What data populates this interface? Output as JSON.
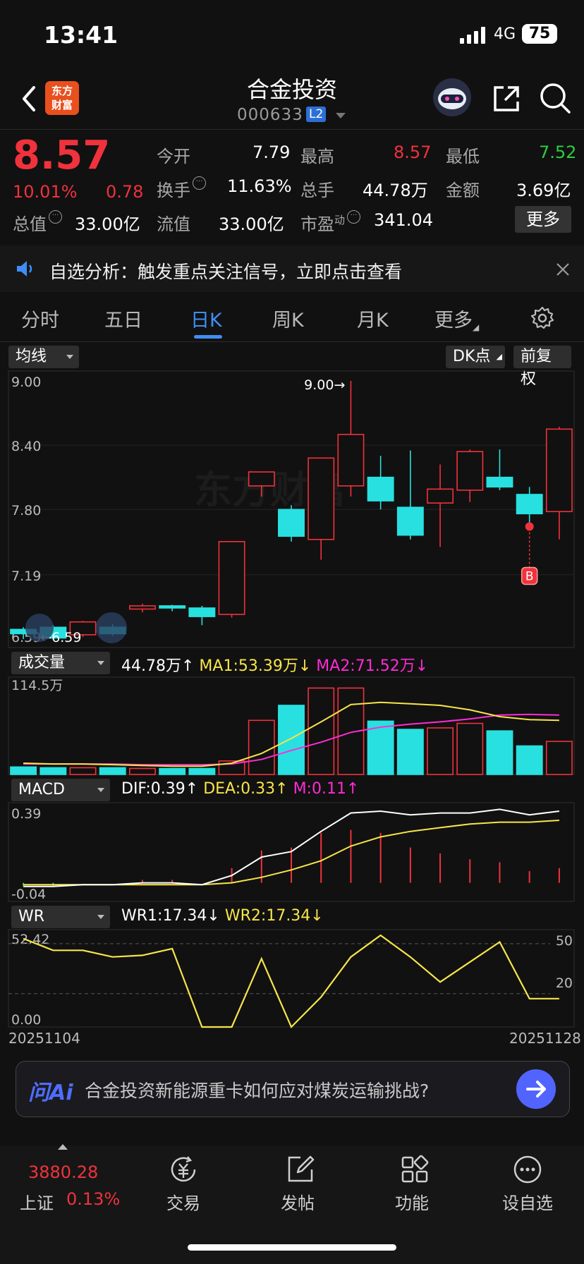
{
  "status_bar": {
    "time": "13:41",
    "network": "4G",
    "battery": "75"
  },
  "header": {
    "name": "合金投资",
    "code": "000633",
    "level": "L2",
    "logo_line1": "东方",
    "logo_line2": "财富"
  },
  "quote": {
    "price": "8.57",
    "change_pct": "10.01%",
    "change": "0.78",
    "open_label": "今开",
    "open": "7.79",
    "high_label": "最高",
    "high": "8.57",
    "low_label": "最低",
    "low": "7.52",
    "turnover_label": "换手",
    "turnover": "11.63%",
    "volume_label": "总手",
    "volume": "44.78万",
    "amount_label": "金额",
    "amount": "3.69亿",
    "total_cap_label": "总值",
    "total_cap": "33.00亿",
    "float_cap_label": "流值",
    "float_cap": "33.00亿",
    "pe_label": "市盈",
    "pe_sup": "动",
    "pe": "341.04",
    "more_label": "更多",
    "colors": {
      "up": "#f0323c",
      "down": "#2ecc40"
    }
  },
  "notice": {
    "text": "自选分析：触发重点关注信号，立即点击查看"
  },
  "tabs": [
    {
      "label": "分时"
    },
    {
      "label": "五日"
    },
    {
      "label": "日K",
      "active": true
    },
    {
      "label": "周K"
    },
    {
      "label": "月K"
    },
    {
      "label": "更多"
    }
  ],
  "kline_toolbar": {
    "ma_label": "均线",
    "dk_label": "DK点",
    "adjust_label": "前复权"
  },
  "chart_data": [
    {
      "type": "candlestick",
      "name": "日K",
      "y_ticks": [
        "9.00",
        "8.40",
        "7.80",
        "7.19",
        "6.59"
      ],
      "ylim": [
        6.59,
        9.0
      ],
      "max_label": "9.00→",
      "min_label": "←6.59",
      "signal_marker": "B",
      "watermark": "东方财富",
      "colors": {
        "up": "#f0323c",
        "down": "#28e0e0"
      },
      "candles": [
        {
          "o": 6.68,
          "c": 6.64,
          "h": 6.7,
          "l": 6.59
        },
        {
          "o": 6.7,
          "c": 6.6,
          "h": 6.72,
          "l": 6.59
        },
        {
          "o": 6.63,
          "c": 6.75,
          "h": 6.76,
          "l": 6.61
        },
        {
          "o": 6.7,
          "c": 6.64,
          "h": 6.73,
          "l": 6.62
        },
        {
          "o": 6.87,
          "c": 6.9,
          "h": 6.92,
          "l": 6.84
        },
        {
          "o": 6.9,
          "c": 6.88,
          "h": 6.91,
          "l": 6.85
        },
        {
          "o": 6.88,
          "c": 6.8,
          "h": 6.9,
          "l": 6.72
        },
        {
          "o": 6.82,
          "c": 7.5,
          "h": 7.5,
          "l": 6.79
        },
        {
          "o": 8.02,
          "c": 8.15,
          "h": 8.15,
          "l": 7.92
        },
        {
          "o": 7.8,
          "c": 7.55,
          "h": 7.84,
          "l": 7.5
        },
        {
          "o": 7.52,
          "c": 8.28,
          "h": 8.28,
          "l": 7.33
        },
        {
          "o": 8.02,
          "c": 8.5,
          "h": 9.0,
          "l": 7.92
        },
        {
          "o": 8.1,
          "c": 7.88,
          "h": 8.3,
          "l": 7.8
        },
        {
          "o": 7.82,
          "c": 7.56,
          "h": 8.35,
          "l": 7.52
        },
        {
          "o": 7.86,
          "c": 7.99,
          "h": 8.22,
          "l": 7.45
        },
        {
          "o": 7.98,
          "c": 8.34,
          "h": 8.36,
          "l": 7.87
        },
        {
          "o": 8.1,
          "c": 8.01,
          "h": 8.36,
          "l": 7.98
        },
        {
          "o": 7.94,
          "c": 7.76,
          "h": 8.01,
          "l": 7.68
        },
        {
          "o": 7.78,
          "c": 8.55,
          "h": 8.57,
          "l": 7.52
        }
      ]
    },
    {
      "type": "bar",
      "name": "成交量",
      "label": "成交量",
      "y_ticks": [
        "114.5万"
      ],
      "ylim": [
        0,
        114.5
      ],
      "indicators": [
        {
          "text": "44.78万↑",
          "color": "#ffffff"
        },
        {
          "text": "MA1:53.39万↓",
          "color": "#f7e54a"
        },
        {
          "text": "MA2:71.52万↓",
          "color": "#ff2bd5"
        }
      ],
      "values": [
        10,
        9,
        9,
        9,
        8,
        8,
        8,
        18,
        72,
        92,
        115,
        115,
        71,
        60,
        62,
        68,
        58,
        38,
        44
      ],
      "ma1": [
        15,
        14,
        14,
        13,
        12,
        11,
        11,
        15,
        28,
        48,
        70,
        93,
        96,
        94,
        92,
        86,
        77,
        73,
        72
      ],
      "ma2": [
        14,
        14,
        14,
        14,
        13,
        13,
        13,
        14,
        20,
        32,
        43,
        56,
        63,
        67,
        70,
        74,
        79,
        80,
        79
      ]
    },
    {
      "type": "line",
      "name": "MACD",
      "label": "MACD",
      "y_ticks": [
        "0.39",
        "-0.04"
      ],
      "ylim": [
        -0.04,
        0.39
      ],
      "indicators": [
        {
          "text": "DIF:0.39↑",
          "color": "#ffffff"
        },
        {
          "text": "DEA:0.33↑",
          "color": "#f7e54a"
        },
        {
          "text": "M:0.11↑",
          "color": "#ff2bd5"
        }
      ],
      "dif": [
        -0.02,
        -0.02,
        -0.01,
        -0.01,
        0.0,
        0.0,
        -0.01,
        0.04,
        0.14,
        0.17,
        0.28,
        0.38,
        0.39,
        0.37,
        0.38,
        0.38,
        0.4,
        0.37,
        0.39
      ],
      "dea": [
        -0.01,
        -0.01,
        -0.01,
        -0.01,
        -0.01,
        -0.01,
        -0.01,
        0.0,
        0.03,
        0.07,
        0.12,
        0.2,
        0.25,
        0.28,
        0.3,
        0.32,
        0.33,
        0.33,
        0.34
      ],
      "m": [
        -0.01,
        -0.01,
        0.0,
        0.0,
        0.01,
        0.01,
        0.0,
        0.05,
        0.11,
        0.12,
        0.17,
        0.18,
        0.17,
        0.12,
        0.1,
        0.08,
        0.07,
        0.04,
        0.05
      ]
    },
    {
      "type": "line",
      "name": "WR",
      "label": "WR",
      "y_ticks": [
        "52.42",
        "0.00"
      ],
      "right_ticks": [
        "50",
        "20"
      ],
      "ylim": [
        0,
        52.42
      ],
      "indicators": [
        {
          "text": "WR1:17.34↓",
          "color": "#ffffff"
        },
        {
          "text": "WR2:17.34↓",
          "color": "#f7e54a"
        }
      ],
      "wr": [
        53,
        46,
        46,
        42,
        43,
        47,
        0,
        0,
        41,
        0,
        18,
        42,
        55,
        42,
        27,
        39,
        51,
        17,
        17
      ],
      "x_start": "20251104",
      "x_end": "20251128"
    }
  ],
  "ai_bar": {
    "logo": "问Ai",
    "text": "合金投资新能源重卡如何应对煤炭运输挑战?"
  },
  "bottom_nav": {
    "index_value": "3880.28",
    "index_name": "上证",
    "index_pct": "0.13%",
    "items": [
      {
        "label": "交易"
      },
      {
        "label": "发帖"
      },
      {
        "label": "功能"
      },
      {
        "label": "设自选"
      }
    ]
  }
}
